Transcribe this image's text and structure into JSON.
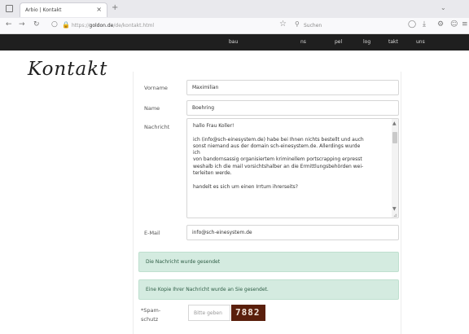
{
  "browser": {
    "tab_title": "Arbio | Kontakt",
    "tab_close": "×",
    "new_tab": "+",
    "url_prefix": "https://",
    "url_domain": "goldon.de",
    "url_path": "/de/kontakt.html",
    "search_placeholder": "Suchen"
  },
  "site_nav": {
    "items": [
      "bau",
      "ns",
      "pel",
      "log",
      "takt",
      "uns"
    ]
  },
  "page": {
    "title": "Kontakt"
  },
  "form": {
    "vorname_label": "Vorname",
    "vorname_value": "Maximilian",
    "name_label": "Name",
    "name_value": "Boehring",
    "nachricht_label": "Nachricht",
    "nachricht_lines": [
      "hallo Frau Koller!",
      "",
      "ich (info@sch-einesystem.de) habe bei Ihnen nichts bestellt und auch",
      "sonst niemand aus der domain sch-einesystem.de. Allerdings wurde",
      "ich",
      "von bandornsassig organisiertem kriminellem portscrapping erpresst",
      "weshalb ich die mail vorsichtshalber an die Ermittlungsbehörden wei-",
      "terleiten werde.",
      "",
      "handelt es sich um einen Irrtum ihrerseits?"
    ],
    "email_label": "E-Mail",
    "email_value": "info@sch-einesystem.de",
    "alert_sent": "Die Nachricht wurde gesendet",
    "alert_copy": "Eine Kopie Ihrer Nachricht wurde an Sie gesendet.",
    "captcha_label_line1": "*Spam-",
    "captcha_label_line2": "schutz",
    "captcha_placeholder": "Bitte geben",
    "captcha_code": "7882"
  }
}
